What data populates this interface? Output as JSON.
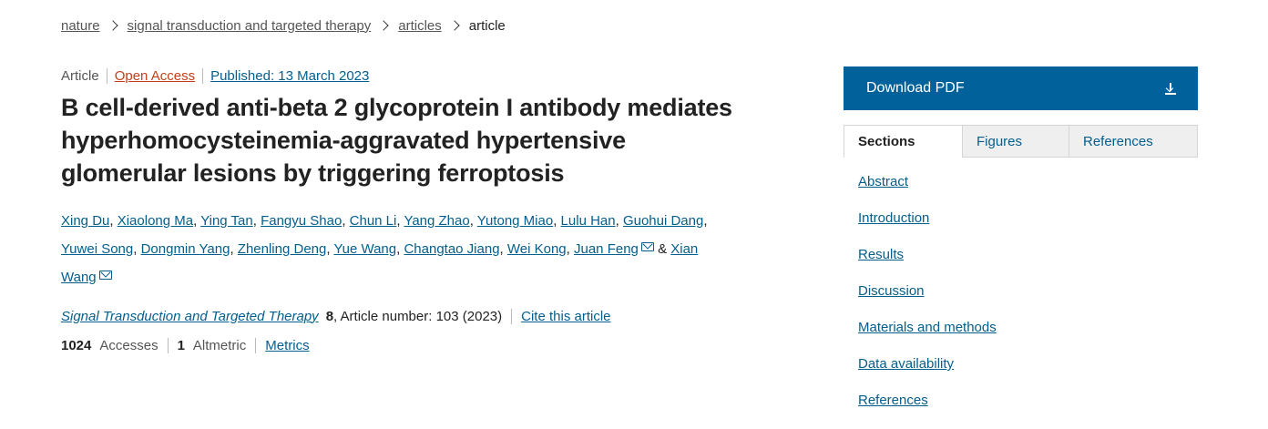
{
  "breadcrumb": {
    "items": [
      "nature",
      "signal transduction and targeted therapy",
      "articles"
    ],
    "current": "article"
  },
  "article": {
    "type": "Article",
    "open_access": "Open Access",
    "published": "Published: 13 March 2023",
    "title": "B cell-derived anti-beta 2 glycoprotein I antibody mediates hyperhomocysteinemia-aggravated hypertensive glomerular lesions by triggering ferroptosis",
    "authors": [
      "Xing Du",
      "Xiaolong Ma",
      "Ying Tan",
      "Fangyu Shao",
      "Chun Li",
      "Yang Zhao",
      "Yutong Miao",
      "Lulu Han",
      "Guohui Dang",
      "Yuwei Song",
      "Dongmin Yang",
      "Zhenling Deng",
      "Yue Wang",
      "Changtao Jiang",
      "Wei Kong",
      "Juan Feng",
      "Xian Wang"
    ],
    "ampersand": "&",
    "journal": "Signal Transduction and Targeted Therapy",
    "volume": "8",
    "article_number": ", Article number: 103 (2023)",
    "cite_label": "Cite this article",
    "accesses_count": "1024",
    "accesses_label": "Accesses",
    "altmetric_count": "1",
    "altmetric_label": "Altmetric",
    "metrics_label": "Metrics"
  },
  "sidebar": {
    "download_label": "Download PDF",
    "tabs": [
      "Sections",
      "Figures",
      "References"
    ],
    "active_tab": "Sections",
    "sections": [
      "Abstract",
      "Introduction",
      "Results",
      "Discussion",
      "Materials and methods",
      "Data availability",
      "References"
    ]
  },
  "colors": {
    "link": "#025e8d",
    "open_access": "#c33f1c",
    "download_bg": "#01629b"
  },
  "icons": [
    "chevron-right-icon",
    "mail-icon",
    "download-icon"
  ]
}
